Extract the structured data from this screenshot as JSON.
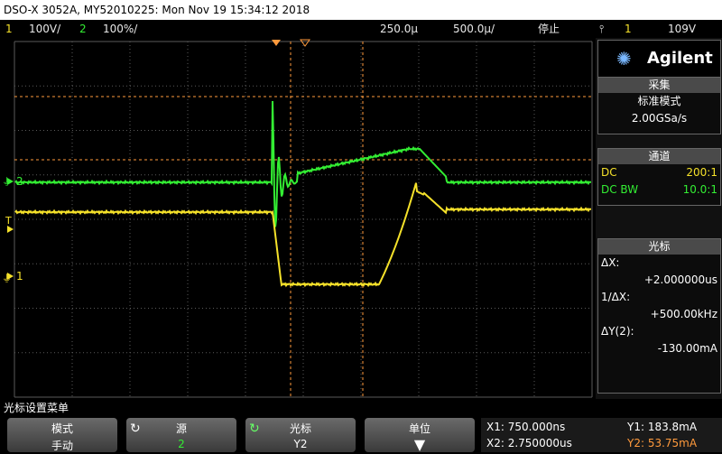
{
  "title": "DSO-X 3052A, MY52010225: Mon Nov 19 15:34:12 2018",
  "status": {
    "ch1_num": "1",
    "ch1_scale": "100V/",
    "ch2_num": "2",
    "ch2_scale": "100%/",
    "time_pos": "250.0µ",
    "time_scale": "500.0µ/",
    "run_state": "停止",
    "trig_icon": "⫯",
    "trig_ch": "1",
    "trig_level": "109V"
  },
  "screen": {
    "ch1_marker": "1",
    "ch2_marker": "2",
    "trig_marker": "T"
  },
  "panel": {
    "brand": "Agilent",
    "acq_title": "采集",
    "acq_mode": "标准模式",
    "acq_rate": "2.00GSa/s",
    "ch_title": "通道",
    "ch1_coupling": "DC",
    "ch1_probe": "200:1",
    "ch2_coupling": "DC BW",
    "ch2_probe": "10.0:1",
    "cursor_title": "光标",
    "dx_label": "ΔX:",
    "dx_value": "+2.000000us",
    "inv_dx_label": "1/ΔX:",
    "inv_dx_value": "+500.00kHz",
    "dy_label": "ΔY(2):",
    "dy_value": "-130.00mA"
  },
  "menu": {
    "label": "光标设置菜单",
    "keys": [
      {
        "title": "模式",
        "value": "手动"
      },
      {
        "title": "源",
        "value": "2"
      },
      {
        "title": "光标",
        "value": "Y2"
      },
      {
        "title": "单位",
        "value": ""
      }
    ],
    "x1": "X1: 750.000ns",
    "x2": "X2: 2.750000us",
    "y1": "Y1: 183.8mA",
    "y2": "Y2: 53.75mA"
  },
  "colors": {
    "ch1": "#f5e12a",
    "ch2": "#33ee33",
    "cursor": "#ff9a3c",
    "grid": "#5a5a5a"
  }
}
